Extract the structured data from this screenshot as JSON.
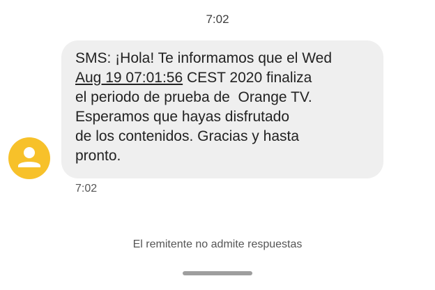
{
  "conversation": {
    "top_timestamp": "7:02",
    "message": {
      "line1": "SMS: ¡Hola! Te informamos que el Wed",
      "date_link": "Aug 19 07:01:56",
      "line2_rest": " CEST 2020 finaliza",
      "line3": "el periodo de prueba de  Orange TV.",
      "line4": "Esperamos que hayas disfrutado",
      "line5": "de los contenidos. Gracias y hasta",
      "line6": "pronto.",
      "time": "7:02"
    },
    "sender_avatar": {
      "icon": "person-icon",
      "color": "#f7c12a"
    },
    "footer_note": "El remitente no admite respuestas"
  },
  "colors": {
    "bubble_background": "#efefef",
    "text": "#222222",
    "secondary_text": "#555555"
  }
}
